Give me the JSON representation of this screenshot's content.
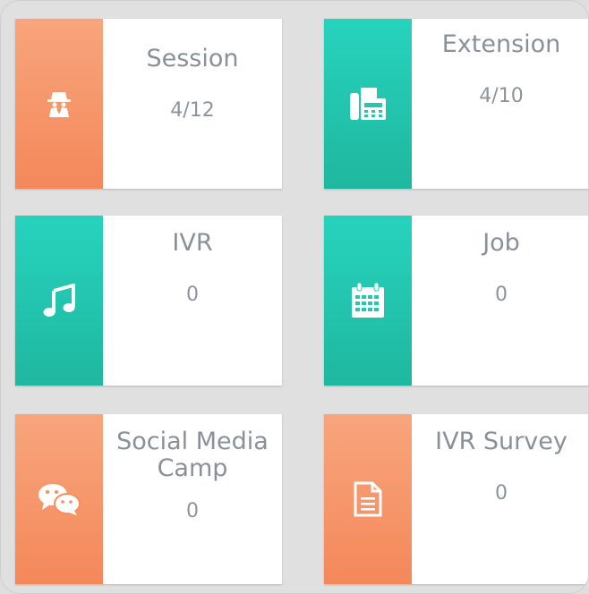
{
  "cards": [
    {
      "title": "Session",
      "value": "4/12",
      "icon": "spy-icon",
      "color": "#f58f62"
    },
    {
      "title": "Extension",
      "value": "4/10",
      "icon": "fax-icon",
      "color": "#22c9b0"
    },
    {
      "title": "IVR",
      "value": "0",
      "icon": "music-icon",
      "color": "#22c9b0"
    },
    {
      "title": "Job",
      "value": "0",
      "icon": "calendar-icon",
      "color": "#22c9b0"
    },
    {
      "title": "Social Media Camp",
      "value": "0",
      "icon": "chat-icon",
      "color": "#f58f62"
    },
    {
      "title": "IVR Survey",
      "value": "0",
      "icon": "document-icon",
      "color": "#f58f62"
    }
  ]
}
